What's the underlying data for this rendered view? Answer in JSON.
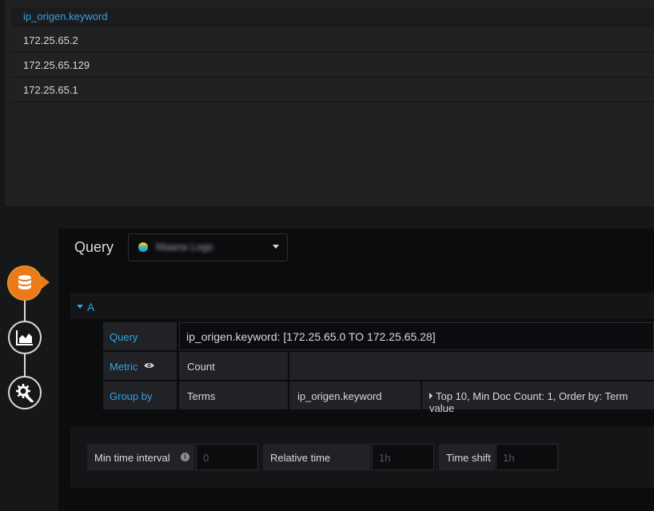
{
  "table": {
    "column_header": "ip_origen.keyword",
    "rows": [
      "172.25.65.2",
      "172.25.65.129",
      "172.25.65.1"
    ]
  },
  "editor": {
    "title": "Query",
    "datasource": {
      "name": "Maana Logs",
      "logo_icon": "elasticsearch-icon"
    },
    "side_toolbar": [
      {
        "icon": "database-icon",
        "active": true
      },
      {
        "icon": "area-chart-icon",
        "active": false
      },
      {
        "icon": "gear-wrench-icon",
        "active": false
      }
    ],
    "query_a": {
      "ref_id": "A",
      "query_label": "Query",
      "query_value": "ip_origen.keyword: [172.25.65.0 TO 172.25.65.28]",
      "metric_label": "Metric",
      "metric_value": "Count",
      "group_by_label": "Group by",
      "group_by_type": "Terms",
      "group_by_field": "ip_origen.keyword",
      "group_by_options": "Top 10, Min Doc Count: 1, Order by: Term value"
    },
    "options": {
      "min_interval_label": "Min time interval",
      "min_interval_placeholder": "0",
      "relative_time_label": "Relative time",
      "relative_time_placeholder": "1h",
      "time_shift_label": "Time shift",
      "time_shift_placeholder": "1h"
    }
  },
  "colors": {
    "accent_blue": "#33a2e5",
    "active_orange": "#eb7b18"
  }
}
